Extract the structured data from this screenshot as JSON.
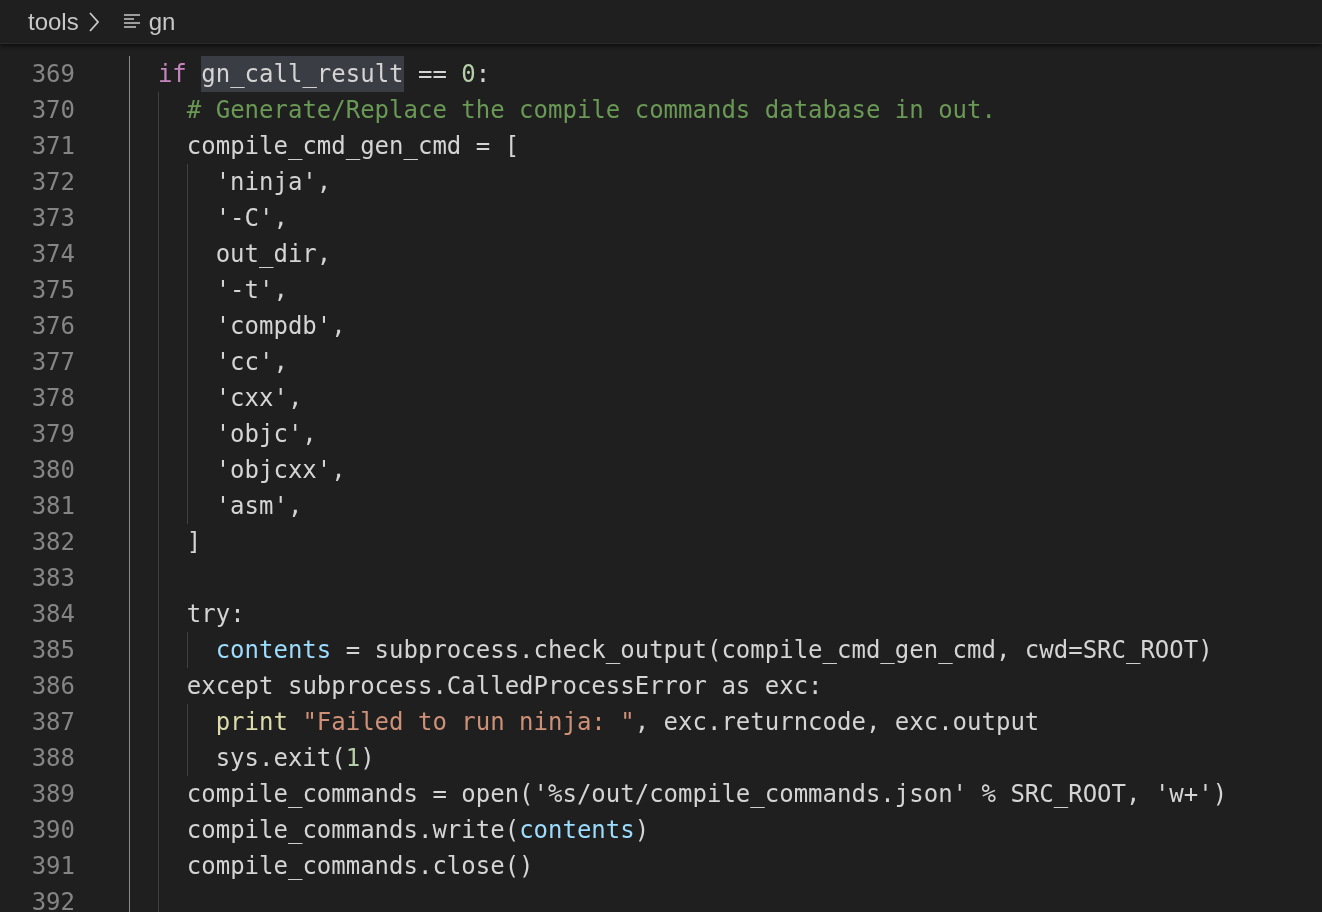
{
  "breadcrumb": [
    {
      "label": "tools",
      "kind": "folder"
    },
    {
      "label": "gn",
      "kind": "file"
    }
  ],
  "lines": [
    {
      "number": "369",
      "tokens": [
        {
          "text": "if ",
          "kind": "keyword"
        },
        {
          "text": "gn_call_result",
          "kind": "match"
        },
        {
          "text": " == ",
          "kind": "plain"
        },
        {
          "text": "0",
          "kind": "number"
        },
        {
          "text": ":",
          "kind": "plain"
        }
      ],
      "children": [
        {
          "number": "370",
          "tokens": [
            {
              "text": "# Generate/Replace the compile commands database in out.",
              "kind": "comment"
            }
          ]
        },
        {
          "number": "371",
          "tokens": [
            {
              "text": "compile_cmd_gen_cmd = [",
              "kind": "plain"
            }
          ],
          "children": [
            {
              "number": "372",
              "tokens": [
                {
                  "text": "'ninja',",
                  "kind": "plain"
                }
              ]
            },
            {
              "number": "373",
              "tokens": [
                {
                  "text": "'-C',",
                  "kind": "plain"
                }
              ]
            },
            {
              "number": "374",
              "tokens": [
                {
                  "text": "out_dir,",
                  "kind": "plain"
                }
              ]
            },
            {
              "number": "375",
              "tokens": [
                {
                  "text": "'-t',",
                  "kind": "plain"
                }
              ]
            },
            {
              "number": "376",
              "tokens": [
                {
                  "text": "'compdb',",
                  "kind": "plain"
                }
              ]
            },
            {
              "number": "377",
              "tokens": [
                {
                  "text": "'cc',",
                  "kind": "plain"
                }
              ]
            },
            {
              "number": "378",
              "tokens": [
                {
                  "text": "'cxx',",
                  "kind": "plain"
                }
              ]
            },
            {
              "number": "379",
              "tokens": [
                {
                  "text": "'objc',",
                  "kind": "plain"
                }
              ]
            },
            {
              "number": "380",
              "tokens": [
                {
                  "text": "'objcxx',",
                  "kind": "plain"
                }
              ]
            },
            {
              "number": "381",
              "tokens": [
                {
                  "text": "'asm',",
                  "kind": "plain"
                }
              ]
            }
          ]
        },
        {
          "number": "382",
          "tokens": [
            {
              "text": "]",
              "kind": "plain"
            }
          ]
        },
        {
          "number": "383"
        },
        {
          "number": "384",
          "tokens": [
            {
              "text": "try:",
              "kind": "plain"
            }
          ],
          "children": [
            {
              "number": "385",
              "tokens": [
                {
                  "text": "contents",
                  "kind": "variable"
                },
                {
                  "text": " = subprocess.check_output(compile_cmd_gen_cmd, cwd=SRC_ROOT)",
                  "kind": "plain"
                }
              ]
            }
          ]
        },
        {
          "number": "386",
          "tokens": [
            {
              "text": "except subprocess.CalledProcessError as exc:",
              "kind": "plain"
            }
          ],
          "children": [
            {
              "number": "387",
              "tokens": [
                {
                  "text": "print ",
                  "kind": "function"
                },
                {
                  "text": "\"Failed to run ninja: \"",
                  "kind": "string"
                },
                {
                  "text": ", exc.returncode, exc.output",
                  "kind": "plain"
                }
              ]
            },
            {
              "number": "388",
              "tokens": [
                {
                  "text": "sys.exit(",
                  "kind": "plain"
                },
                {
                  "text": "1",
                  "kind": "number"
                },
                {
                  "text": ")",
                  "kind": "plain"
                }
              ]
            }
          ]
        },
        {
          "number": "389",
          "tokens": [
            {
              "text": "compile_commands = open('%s/out/compile_commands.json' % SRC_ROOT, 'w+')",
              "kind": "plain"
            }
          ]
        },
        {
          "number": "390",
          "tokens": [
            {
              "text": "compile_commands.write(",
              "kind": "plain"
            },
            {
              "text": "contents",
              "kind": "variable"
            },
            {
              "text": ")",
              "kind": "plain"
            }
          ]
        },
        {
          "number": "391",
          "tokens": [
            {
              "text": "compile_commands.close()",
              "kind": "plain"
            }
          ]
        },
        {
          "number": "392"
        }
      ]
    }
  ]
}
